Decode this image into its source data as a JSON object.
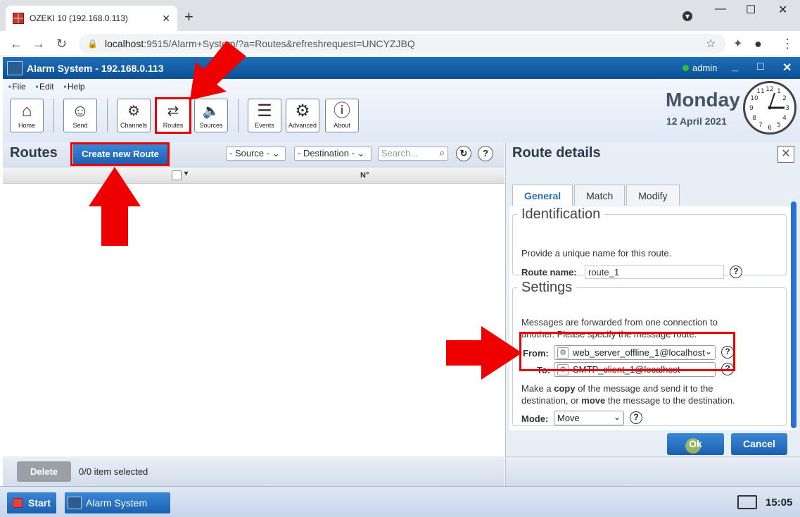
{
  "browser": {
    "tab_title": "OZEKI 10 (192.168.0.113)",
    "url_host": "localhost",
    "url_rest": ":9515/Alarm+System/?a=Routes&refreshrequest=UNCYZJBQ"
  },
  "app": {
    "title": "Alarm System - 192.168.0.113",
    "user": "admin"
  },
  "menu": [
    "File",
    "Edit",
    "Help"
  ],
  "toolbar": {
    "home": "Home",
    "send": "Send",
    "channels": "Channels",
    "routes": "Routes",
    "sources": "Sources",
    "events": "Events",
    "advanced": "Advanced",
    "about": "About"
  },
  "datetime": {
    "day": "Monday",
    "date": "12 April 2021"
  },
  "routes_panel": {
    "title": "Routes",
    "create_button": "Create new Route",
    "source_filter": "- Source -",
    "destination_filter": "- Destination -",
    "search_placeholder": "Search...",
    "column_number": "N°",
    "delete_button": "Delete",
    "selection_status": "0/0 item selected"
  },
  "route_details": {
    "title": "Route details",
    "tabs": [
      "General",
      "Match",
      "Modify"
    ],
    "identification": {
      "legend": "Identification",
      "description": "Provide a unique name for this route.",
      "route_name_label": "Route name:",
      "route_name_value": "route_1"
    },
    "settings": {
      "legend": "Settings",
      "description_line1": "Messages are forwarded from one connection to",
      "description_line2": "another. Please specify the message route.",
      "from_label": "From:",
      "from_value": "web_server_offline_1@localhost",
      "to_label": "To:",
      "to_value": "SMTP_client_1@localhost",
      "mode_desc_1": "Make a ",
      "mode_desc_copy": "copy",
      "mode_desc_2": " of the message and send it to the",
      "mode_desc_3": "destination, or ",
      "mode_desc_move": "move",
      "mode_desc_4": " the message to the destination.",
      "mode_label": "Mode:",
      "mode_value": "Move"
    },
    "ok_button": "Ok",
    "cancel_button": "Cancel"
  },
  "taskbar": {
    "start": "Start",
    "app_item": "Alarm System",
    "time": "15:05"
  },
  "colors": {
    "highlight": "#e00000",
    "accent": "#1c5fb0"
  }
}
